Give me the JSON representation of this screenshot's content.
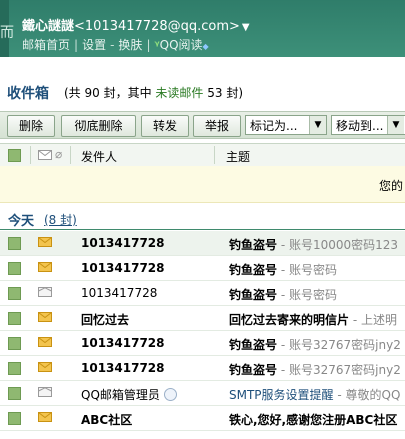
{
  "header": {
    "logo_glyph": "而",
    "user_name": "鐵心謎謎",
    "user_email": "<1013417728@qq.com>",
    "links": [
      "邮箱首页",
      "设置",
      "换肤",
      "QQ阅读"
    ]
  },
  "inbox": {
    "title": "收件箱",
    "summary_prefix": "(共 90 封，其中",
    "unread_label": "未读邮件",
    "summary_suffix": "53 封)"
  },
  "toolbar": {
    "delete": "删除",
    "delete_forever": "彻底删除",
    "forward": "转发",
    "report": "举报",
    "mark_as": "标记为...",
    "move_to": "移动到..."
  },
  "columns": {
    "sender": "发件人",
    "subject": "主题"
  },
  "notice": {
    "text": "您的"
  },
  "group": {
    "title": "今天",
    "count": "(8 封)"
  },
  "colors": {
    "header_green": "#2f7d6a",
    "link_blue": "#1e4f7a",
    "unread_green": "#2a7a23"
  },
  "mails": [
    {
      "sender": "1013417728",
      "sender_bold": true,
      "subject": "钓鱼盗号",
      "preview": " - 账号10000密码123",
      "read": false
    },
    {
      "sender": "1013417728",
      "sender_bold": true,
      "subject": "钓鱼盗号",
      "preview": " - 账号密码",
      "read": false
    },
    {
      "sender": "1013417728",
      "sender_bold": false,
      "subject": "钓鱼盗号",
      "preview": " - 账号密码",
      "read": true
    },
    {
      "sender": "回忆过去",
      "sender_bold": true,
      "subject": "回忆过去寄来的明信片",
      "preview": " - 上述明",
      "read": false
    },
    {
      "sender": "1013417728",
      "sender_bold": true,
      "subject": "钓鱼盗号",
      "preview": " - 账号32767密码jny2",
      "read": false
    },
    {
      "sender": "1013417728",
      "sender_bold": true,
      "subject": "钓鱼盗号",
      "preview": " - 账号32767密码jny2",
      "read": false
    },
    {
      "sender": "QQ邮箱管理员",
      "sender_bold": false,
      "subject": "SMTP服务设置提醒",
      "preview": " - 尊敬的QQ",
      "read": true,
      "subject_link": true,
      "badge": true
    },
    {
      "sender": "ABC社区",
      "sender_bold": true,
      "subject": "铁心,您好,感谢您注册ABC社区",
      "preview": "",
      "read": false
    }
  ]
}
